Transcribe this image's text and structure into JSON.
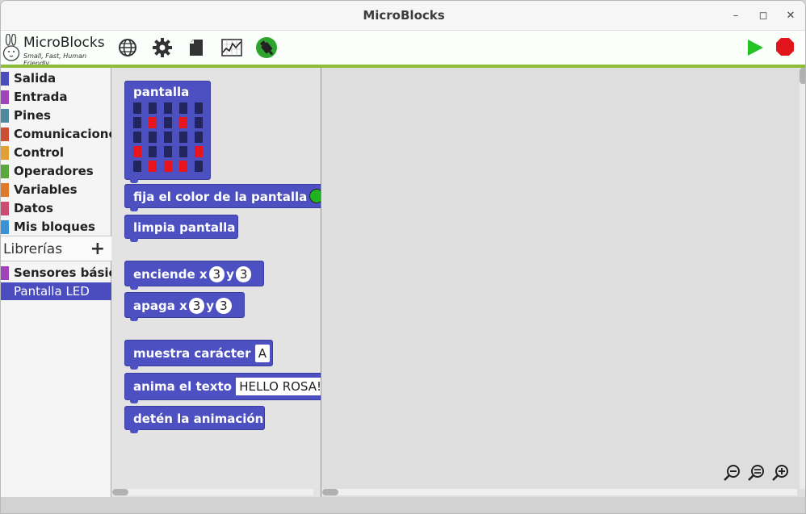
{
  "window": {
    "title": "MicroBlocks"
  },
  "logo": {
    "name": "MicroBlocks",
    "tagline": "Small, Fast, Human Friendly"
  },
  "toolbar": {
    "icons": [
      "globe-icon",
      "gear-icon",
      "file-icon",
      "graph-icon",
      "usb-connected-icon",
      "run-icon",
      "stop-icon"
    ]
  },
  "categories": [
    {
      "label": "Salida",
      "color": "#4b4dbf"
    },
    {
      "label": "Entrada",
      "color": "#a043b8"
    },
    {
      "label": "Pines",
      "color": "#4d8aa0"
    },
    {
      "label": "Comunicaciones",
      "color": "#cc4f34"
    },
    {
      "label": "Control",
      "color": "#e2a034"
    },
    {
      "label": "Operadores",
      "color": "#5aa83d"
    },
    {
      "label": "Variables",
      "color": "#e07a2b"
    },
    {
      "label": "Datos",
      "color": "#cc4c72"
    },
    {
      "label": "Mis bloques",
      "color": "#3a92d6"
    }
  ],
  "libraries": {
    "header": "Librerías",
    "add_symbol": "+",
    "items": [
      {
        "label": "Sensores básicos",
        "color": "#a043b8"
      },
      {
        "label": "Pantalla LED",
        "selected": true
      }
    ]
  },
  "blocks": {
    "display": {
      "label": "pantalla",
      "grid": [
        [
          0,
          0,
          0,
          0,
          0
        ],
        [
          0,
          1,
          0,
          1,
          0
        ],
        [
          0,
          0,
          0,
          0,
          0
        ],
        [
          1,
          0,
          0,
          0,
          1
        ],
        [
          0,
          1,
          1,
          1,
          0
        ]
      ],
      "on_color": "#e8151c",
      "off_color": "#23255e"
    },
    "set_color": {
      "label": "fija el color de la pantalla a",
      "swatch": "#22b122"
    },
    "clear": {
      "label": "limpia pantalla"
    },
    "plot": {
      "label1": "enciende x",
      "x": "3",
      "label2": "y",
      "y": "3"
    },
    "unplot": {
      "label1": "apaga x",
      "x": "3",
      "label2": "y",
      "y": "3"
    },
    "show_char": {
      "label": "muestra carácter",
      "value": "A"
    },
    "scroll_text": {
      "label": "anima el texto",
      "value": "HELLO ROSA!"
    },
    "stop_anim": {
      "label": "detén la animación"
    }
  },
  "zoom": {
    "icons": [
      "zoom-out-icon",
      "zoom-reset-icon",
      "zoom-in-icon"
    ]
  }
}
